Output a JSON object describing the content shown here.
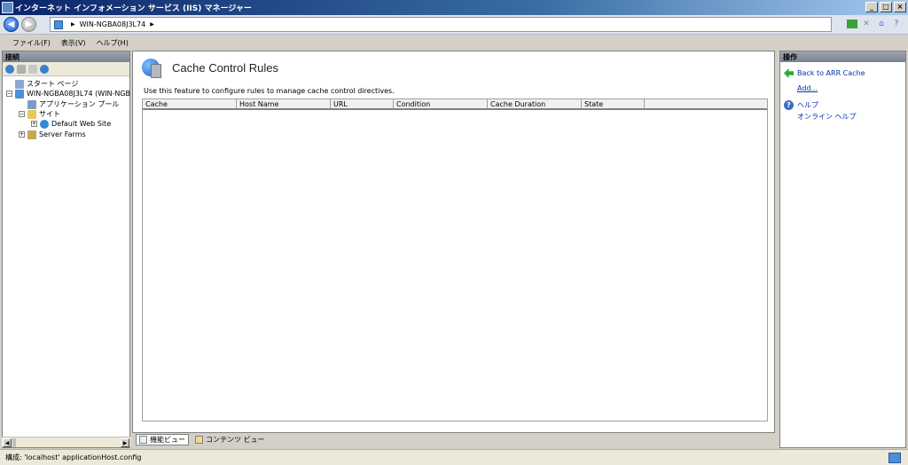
{
  "window": {
    "title": "インターネット インフォメーション サービス (IIS) マネージャー"
  },
  "navbar": {
    "path": [
      "WIN-NGBA08J3L74"
    ]
  },
  "menu": [
    "ファイル(F)",
    "表示(V)",
    "ヘルプ(H)"
  ],
  "connections": {
    "header": "接続",
    "tree": [
      {
        "label": "スタート ページ"
      },
      {
        "label": "WIN-NGBA08J3L74 (WIN-NGB"
      },
      {
        "label": "アプリケーション プール"
      },
      {
        "label": "サイト"
      },
      {
        "label": "Default Web Site"
      },
      {
        "label": "Server Farms"
      }
    ]
  },
  "feature": {
    "title": "Cache Control Rules",
    "description": "Use this feature to configure rules to manage cache control directives.",
    "columns": [
      "Cache",
      "Host Name",
      "URL",
      "Condition",
      "Cache Duration",
      "State"
    ]
  },
  "view_tabs": {
    "features": "機能ビュー",
    "content": "コンテンツ ビュー"
  },
  "actions": {
    "header": "操作",
    "back": "Back to ARR Cache",
    "add": "Add...",
    "help": "ヘルプ",
    "online_help": "オンライン ヘルプ"
  },
  "status": {
    "text": "構成: 'localhost' applicationHost.config"
  }
}
